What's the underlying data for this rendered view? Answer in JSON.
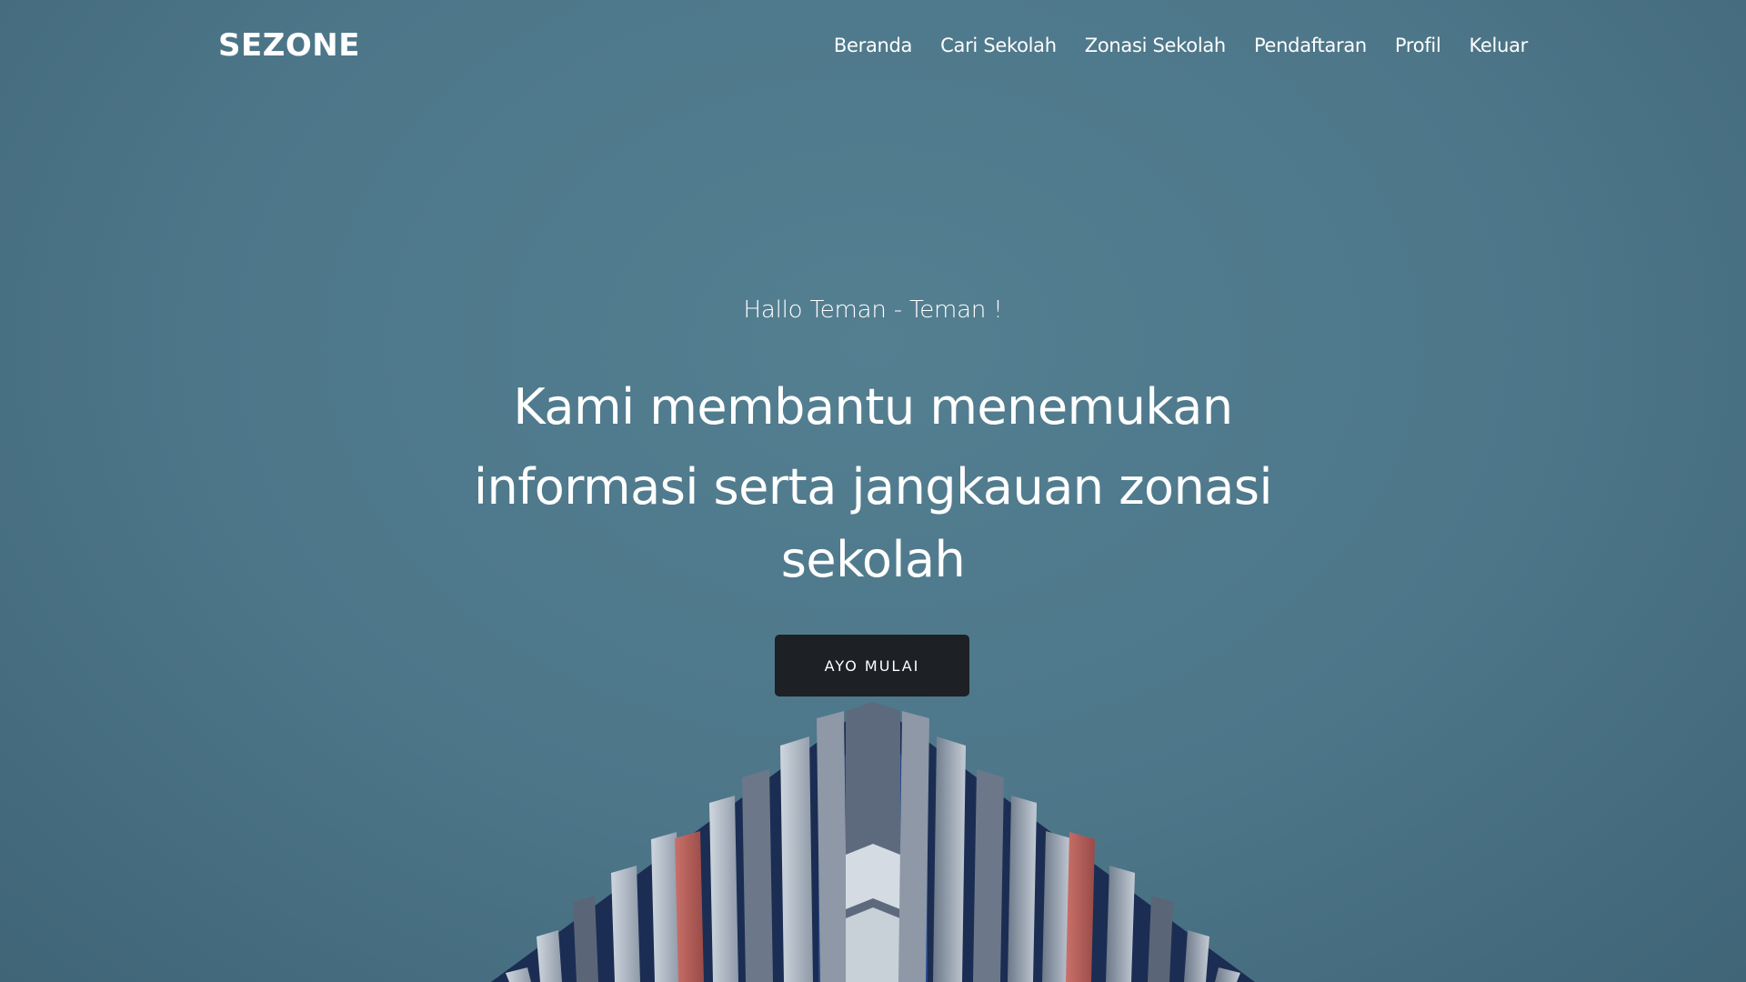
{
  "brand": {
    "name": "SEZONE"
  },
  "nav": {
    "items": [
      {
        "label": "Beranda"
      },
      {
        "label": "Cari Sekolah"
      },
      {
        "label": "Zonasi Sekolah"
      },
      {
        "label": "Pendaftaran"
      },
      {
        "label": "Profil"
      },
      {
        "label": "Keluar"
      }
    ]
  },
  "hero": {
    "greeting": "Hallo Teman - Teman !",
    "headline_line1": "Kami membantu menemukan",
    "headline_line2": "informasi serta jangkauan zonasi sekolah",
    "cta_label": "AYO MULAI"
  },
  "colors": {
    "background": "#4f788b",
    "button": "#1d2024",
    "text": "#ffffff",
    "accent_panel": "#b85a55"
  }
}
